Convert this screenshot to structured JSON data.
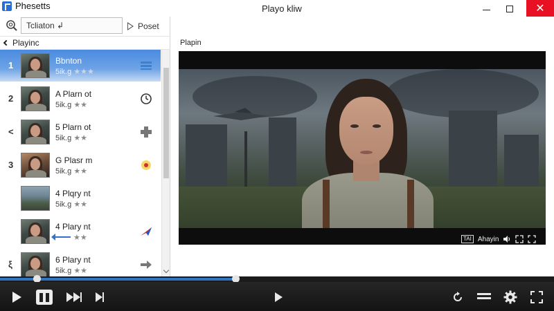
{
  "window": {
    "app_title": "Phesetts",
    "title": "Playo kliw",
    "close_glyph": "✕"
  },
  "sidebar": {
    "search_value": "Tcliaton ↲",
    "poset_label": "Poset",
    "header_label": "Playinc",
    "items": [
      {
        "index": "1",
        "title": "Bbnton",
        "rating_text": "5ik.g",
        "stars": "★★★",
        "action_icon": "queue-icon"
      },
      {
        "index": "2",
        "title": "A Plarn ot",
        "rating_text": "5ik.g",
        "stars": "★★",
        "action_icon": "clock-icon"
      },
      {
        "index": "<",
        "title": "5 Plarn ot",
        "rating_text": "5ik.g",
        "stars": "★★",
        "action_icon": "plus-icon"
      },
      {
        "index": "3",
        "title": "G Plasr m",
        "rating_text": "5ik.g",
        "stars": "★★",
        "action_icon": "record-icon"
      },
      {
        "index": "",
        "title": "4 Plqry nt",
        "rating_text": "5ik.g",
        "stars": "★★",
        "action_icon": "image-icon"
      },
      {
        "index": "",
        "title": "4 Plary nt",
        "rating_text": "",
        "stars": "★★",
        "action_icon": "send-icon"
      },
      {
        "index": "ξ",
        "title": "6 Plary nt",
        "rating_text": "5ik.g",
        "stars": "★★",
        "action_icon": "forward-arrow-icon"
      }
    ]
  },
  "main": {
    "label": "Plapin",
    "video_controls": {
      "cc_label": "TAI",
      "quality_label": "Ahayin"
    }
  },
  "player": {
    "progress": 0.425,
    "accent": "#2f75c6"
  }
}
